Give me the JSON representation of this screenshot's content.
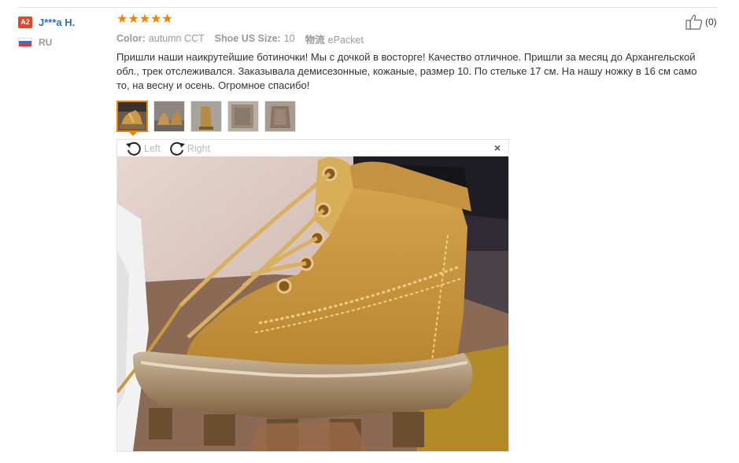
{
  "buyer": {
    "level": "A2",
    "name": "J***a H.",
    "country": "RU"
  },
  "review": {
    "rating": 5,
    "color_label": "Color:",
    "color_value": "autumn CCT",
    "size_label": "Shoe US Size:",
    "size_value": "10",
    "logistics_label": "物流",
    "logistics_value": "ePacket",
    "text": "Пришли наши наикрутейшие ботиночки! Мы с дочкой в восторге! Качество отличное. Пришли за месяц до Архангельской обл., трек отслеживался. Заказывала демисезонные, кожаные, размер 10. По стельке 17 см. На нашу ножку в 16 см само то, на весну и осень. Огромное спасибо!"
  },
  "helpful": {
    "count_text": "(0)"
  },
  "thumbnails": [
    {
      "name": "photo-1",
      "active": true
    },
    {
      "name": "photo-2",
      "active": false
    },
    {
      "name": "photo-3",
      "active": false
    },
    {
      "name": "photo-4",
      "active": false
    },
    {
      "name": "photo-5",
      "active": false
    }
  ],
  "viewer": {
    "rotate_left": "Left",
    "rotate_right": "Right",
    "close": "×"
  },
  "colors": {
    "accent": "#f58200",
    "name_blue": "#2c6fc0",
    "badge_red": "#e5442d"
  }
}
